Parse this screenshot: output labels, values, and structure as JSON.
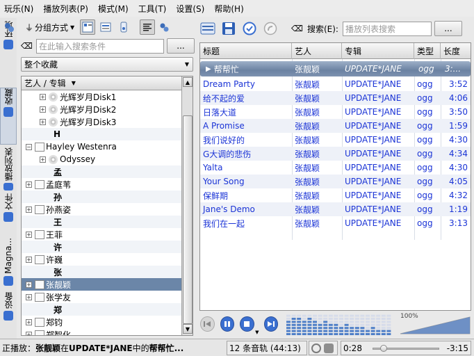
{
  "menu": [
    "玩乐(N)",
    "播放列表(P)",
    "模式(M)",
    "工具(T)",
    "设置(S)",
    "帮助(H)"
  ],
  "vtabs": [
    {
      "label": "环境",
      "icon": "info-icon"
    },
    {
      "label": "收藏",
      "icon": "collection-icon"
    },
    {
      "label": "播放列表",
      "icon": "playlist-icon"
    },
    {
      "label": "文件",
      "icon": "folder-icon"
    },
    {
      "label": "Magna...",
      "icon": "magnatune-icon"
    },
    {
      "label": "设备",
      "icon": "device-icon"
    }
  ],
  "left_toolbar": {
    "group_label": "分组方式"
  },
  "left_search": {
    "placeholder": "在此输入搜索条件",
    "more": "..."
  },
  "collection_combo": "整个收藏",
  "tree": {
    "header": "艺人 / 专辑",
    "rows": [
      {
        "text": "光辉岁月Disk1",
        "kind": "album",
        "indent": 2
      },
      {
        "text": "光辉岁月Disk2",
        "kind": "album",
        "indent": 2
      },
      {
        "text": "光辉岁月Disk3",
        "kind": "album",
        "indent": 2
      },
      {
        "text": "H",
        "kind": "letter"
      },
      {
        "text": "Hayley Westenra",
        "kind": "artist-open"
      },
      {
        "text": "Odyssey",
        "kind": "album",
        "indent": 2
      },
      {
        "text": "孟",
        "kind": "letter"
      },
      {
        "text": "孟庭苇",
        "kind": "artist"
      },
      {
        "text": "孙",
        "kind": "letter"
      },
      {
        "text": "孙燕姿",
        "kind": "artist"
      },
      {
        "text": "王",
        "kind": "letter"
      },
      {
        "text": "王菲",
        "kind": "artist"
      },
      {
        "text": "许",
        "kind": "letter"
      },
      {
        "text": "许巍",
        "kind": "artist"
      },
      {
        "text": "张",
        "kind": "letter"
      },
      {
        "text": "张靓颖",
        "kind": "artist",
        "selected": true
      },
      {
        "text": "张学友",
        "kind": "artist"
      },
      {
        "text": "郑",
        "kind": "letter"
      },
      {
        "text": "郑钧",
        "kind": "artist"
      },
      {
        "text": "郑智化",
        "kind": "artist"
      }
    ]
  },
  "right_toolbar": {
    "search_label": "搜索(E):",
    "search_placeholder": "播放列表搜索",
    "more": "..."
  },
  "playlist": {
    "columns": [
      "标题",
      "艺人",
      "专辑",
      "类型",
      "长度"
    ],
    "current": {
      "title": "帮帮忙",
      "artist": "张靓颖",
      "album": "UPDATE*JANE",
      "type": "ogg",
      "length": "3:..."
    },
    "rows": [
      {
        "title": "Dream Party",
        "artist": "张靓颖",
        "album": "UPDATE*JANE",
        "type": "ogg",
        "length": "3:52"
      },
      {
        "title": "给不起的爱",
        "artist": "张靓颖",
        "album": "UPDATE*JANE",
        "type": "ogg",
        "length": "4:06"
      },
      {
        "title": "日落大道",
        "artist": "张靓颖",
        "album": "UPDATE*JANE",
        "type": "ogg",
        "length": "3:50"
      },
      {
        "title": "A Promise",
        "artist": "张靓颖",
        "album": "UPDATE*JANE",
        "type": "ogg",
        "length": "1:59"
      },
      {
        "title": "我们说好的",
        "artist": "张靓颖",
        "album": "UPDATE*JANE",
        "type": "ogg",
        "length": "4:30"
      },
      {
        "title": "G大调的悲伤",
        "artist": "张靓颖",
        "album": "UPDATE*JANE",
        "type": "ogg",
        "length": "4:34"
      },
      {
        "title": "Yalta",
        "artist": "张靓颖",
        "album": "UPDATE*JANE",
        "type": "ogg",
        "length": "4:30"
      },
      {
        "title": "Your Song",
        "artist": "张靓颖",
        "album": "UPDATE*JANE",
        "type": "ogg",
        "length": "4:05"
      },
      {
        "title": "保鲜期",
        "artist": "张靓颖",
        "album": "UPDATE*JANE",
        "type": "ogg",
        "length": "4:32"
      },
      {
        "title": "Jane's Demo",
        "artist": "张靓颖",
        "album": "UPDATE*JANE",
        "type": "ogg",
        "length": "1:19"
      },
      {
        "title": "我们在一起",
        "artist": "张靓颖",
        "album": "UPDATE*JANE",
        "type": "ogg",
        "length": "3:13"
      }
    ]
  },
  "volume": {
    "label": "100%",
    "level": 1.0
  },
  "status": {
    "now_playing_prefix": "正播放：",
    "artist": "张靓颖",
    "in": " 在 ",
    "album": "UPDATE*JANE",
    "middle": " 中的 ",
    "title": "帮帮忙...",
    "track_count": "12 条音轨 (44:13)",
    "elapsed": "0:28",
    "remaining": "-3:15",
    "progress": 0.13
  },
  "colors": {
    "selection": "#6b86a8",
    "link_text": "#1b34d6",
    "accent": "#3a6fd0"
  }
}
